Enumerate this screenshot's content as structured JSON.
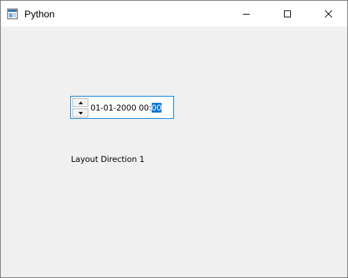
{
  "window": {
    "title": "Python",
    "icon": "python-window-icon"
  },
  "titlebar_buttons": {
    "minimize_icon": "minimize-icon",
    "maximize_icon": "maximize-icon",
    "close_icon": "close-icon"
  },
  "datetime_edit": {
    "value_prefix": "01-01-2000 00:",
    "value_selected": "00",
    "accent_color": "#0078d7"
  },
  "label": {
    "text": "Layout Direction 1"
  }
}
